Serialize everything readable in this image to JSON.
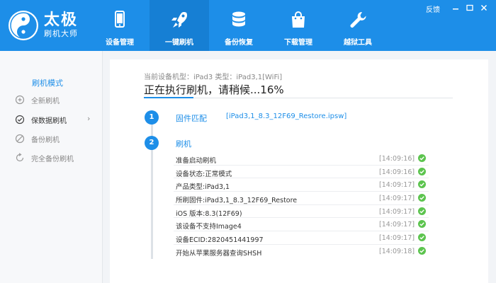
{
  "app": {
    "title": "太极",
    "subtitle": "刷机大师",
    "feedback_label": "反馈"
  },
  "colors": {
    "brand": "#1d8ee8",
    "success": "#5cc44e"
  },
  "nav": [
    {
      "id": "device-manage",
      "label": "设备管理",
      "icon": "phone-icon",
      "active": false
    },
    {
      "id": "one-click-flash",
      "label": "一键刷机",
      "icon": "rocket-icon",
      "active": true
    },
    {
      "id": "backup-restore",
      "label": "备份恢复",
      "icon": "database-icon",
      "active": false
    },
    {
      "id": "download-manage",
      "label": "下载管理",
      "icon": "shopping-bag-icon",
      "active": false
    },
    {
      "id": "jailbreak-tools",
      "label": "越狱工具",
      "icon": "wrench-icon",
      "active": false
    }
  ],
  "sidebar": {
    "title": "刷机模式",
    "items": [
      {
        "label": "全新刷机",
        "icon": "plus-circle-icon",
        "active": false
      },
      {
        "label": "保数据刷机",
        "icon": "check-circle-icon",
        "active": true,
        "chevron": "›"
      },
      {
        "label": "备份刷机",
        "icon": "no-entry-icon",
        "active": false
      },
      {
        "label": "完全备份刷机",
        "icon": "refresh-icon",
        "active": false
      }
    ]
  },
  "main": {
    "device_info": "当前设备机型：iPad3 类型：iPad3,1[WiFi]",
    "status": "正在执行刷机，请稍候...16%",
    "progress_percent": 16,
    "steps": [
      {
        "num": "1",
        "title": "固件匹配",
        "detail": "[iPad3,1_8.3_12F69_Restore.ipsw]"
      },
      {
        "num": "2",
        "title": "刷机"
      }
    ],
    "log": [
      {
        "text": "准备启动刷机",
        "time": "[14:09:16]"
      },
      {
        "text": "设备状态:正常模式",
        "time": "[14:09:16]"
      },
      {
        "text": "产品类型:iPad3,1",
        "time": "[14:09:17]"
      },
      {
        "text": "所刷固件:iPad3,1_8.3_12F69_Restore",
        "time": "[14:09:17]"
      },
      {
        "text": "iOS 版本:8.3(12F69)",
        "time": "[14:09:17]"
      },
      {
        "text": "该设备不支持Image4",
        "time": "[14:09:17]"
      },
      {
        "text": "设备ECID:2820451441997",
        "time": "[14:09:17]"
      },
      {
        "text": "开始从苹果服务器查询SHSH",
        "time": "[14:09:18]"
      }
    ]
  }
}
